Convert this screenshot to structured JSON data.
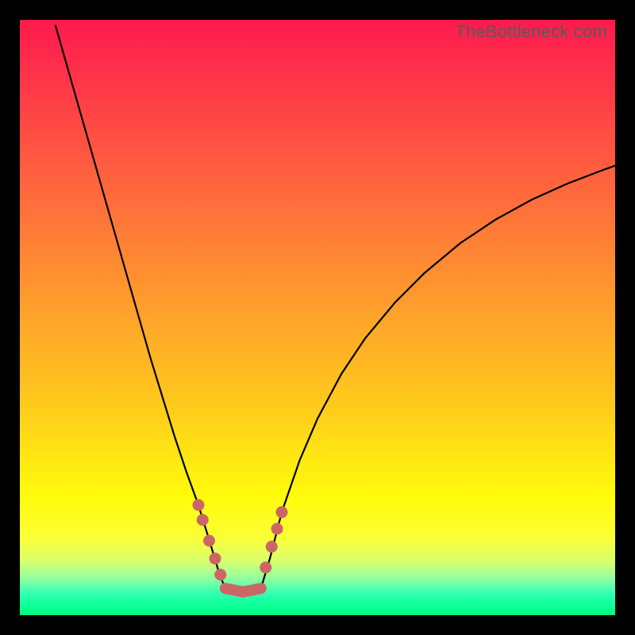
{
  "watermark": "TheBottleneck.com",
  "colors": {
    "bead": "#cc6666",
    "curve": "#000000",
    "frame": "#000000"
  },
  "chart_data": {
    "type": "line",
    "title": "",
    "xlabel": "",
    "ylabel": "",
    "xlim": [
      0,
      100
    ],
    "ylim": [
      0,
      100
    ],
    "trough_x": 36,
    "annotations": {
      "beads_left": [
        {
          "x": 30.0,
          "y": 18.5
        },
        {
          "x": 30.7,
          "y": 16.0
        },
        {
          "x": 31.8,
          "y": 12.5
        },
        {
          "x": 32.8,
          "y": 9.5
        },
        {
          "x": 33.7,
          "y": 6.8
        }
      ],
      "beads_right": [
        {
          "x": 41.3,
          "y": 8.0
        },
        {
          "x": 42.3,
          "y": 11.5
        },
        {
          "x": 43.2,
          "y": 14.5
        },
        {
          "x": 44.0,
          "y": 17.3
        }
      ],
      "floor": {
        "x_start": 34.5,
        "x_end": 40.5,
        "y": 4.5
      }
    },
    "series": [
      {
        "name": "left-branch",
        "x": [
          6.0,
          8.0,
          10.0,
          12.0,
          14.0,
          16.0,
          18.0,
          20.0,
          22.0,
          24.0,
          26.0,
          28.0,
          30.0,
          32.0,
          33.5,
          34.5
        ],
        "y": [
          99.0,
          92.0,
          85.0,
          78.0,
          71.0,
          64.0,
          57.0,
          50.0,
          43.0,
          36.5,
          30.0,
          24.0,
          18.5,
          12.0,
          7.0,
          4.5
        ]
      },
      {
        "name": "floor",
        "x": [
          34.5,
          36.0,
          38.0,
          40.5
        ],
        "y": [
          4.5,
          4.0,
          4.0,
          4.5
        ]
      },
      {
        "name": "right-branch",
        "x": [
          40.5,
          42.0,
          44.0,
          47.0,
          50.0,
          54.0,
          58.0,
          63.0,
          68.0,
          74.0,
          80.0,
          86.0,
          92.0,
          98.0,
          100.0
        ],
        "y": [
          4.5,
          9.5,
          17.3,
          26.0,
          33.0,
          40.5,
          46.5,
          52.5,
          57.5,
          62.5,
          66.5,
          69.8,
          72.5,
          74.8,
          75.5
        ]
      }
    ]
  }
}
